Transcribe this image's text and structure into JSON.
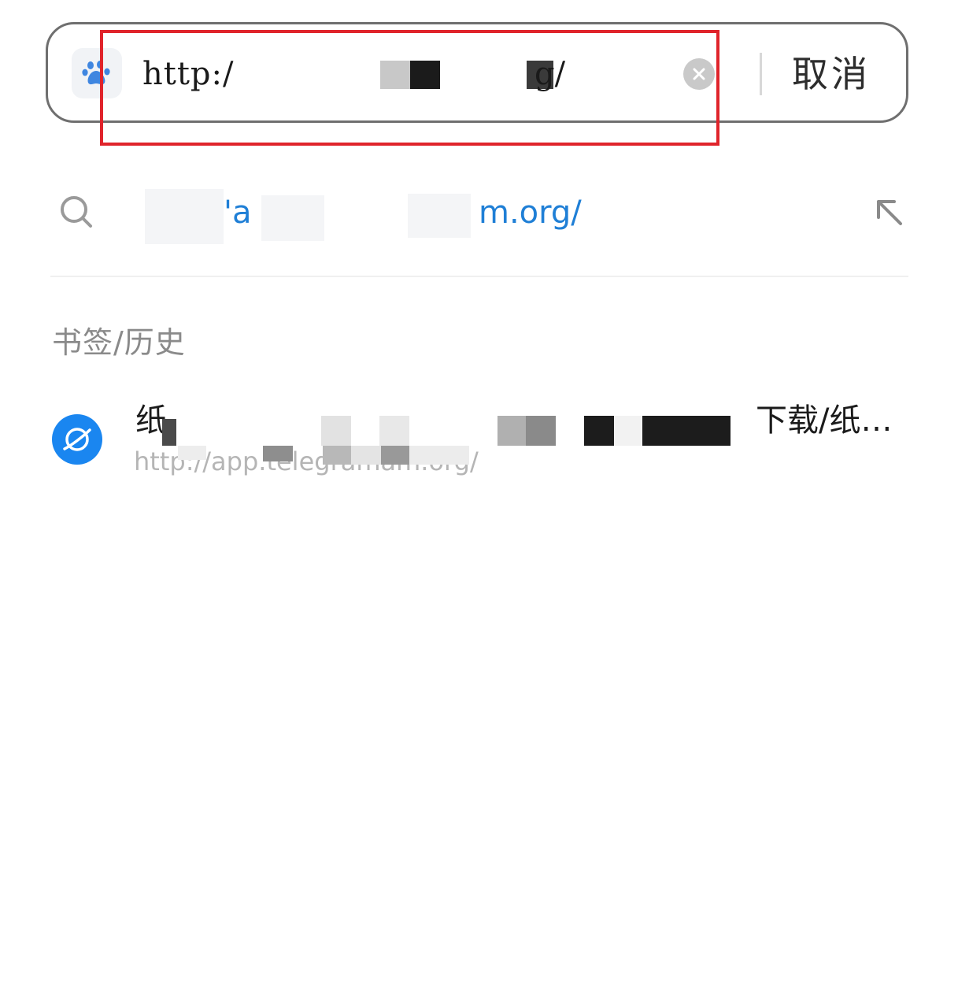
{
  "search_bar": {
    "engine_icon": "baidu-paw-icon",
    "url_prefix": "http:/",
    "url_suffix": "g/",
    "clear_icon": "clear-circle-icon",
    "cancel_label": "取消"
  },
  "suggestion": {
    "icon": "search-icon",
    "text_fragment_a": "'a",
    "text_fragment_b": "m.org/",
    "action_icon": "fill-arrow-up-left-icon"
  },
  "history": {
    "heading": "书签/历史",
    "items": [
      {
        "icon": "site-globe-icon",
        "title_start": "纸",
        "title_end": "下载/纸…",
        "url": "http://app.telegramam.org/"
      }
    ]
  },
  "colors": {
    "link_blue": "#1f7fd6",
    "highlight_red": "#e0242b",
    "site_icon_blue": "#1a86f0"
  }
}
